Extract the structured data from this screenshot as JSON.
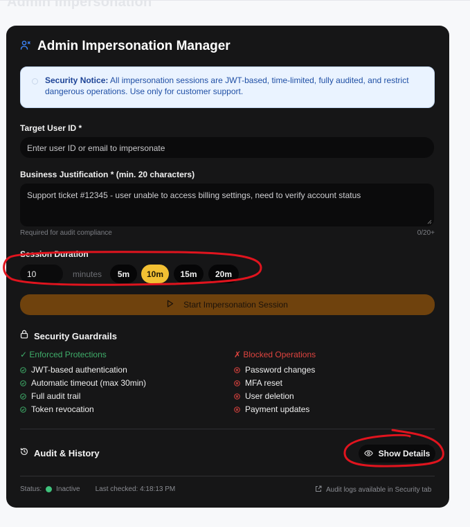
{
  "page": {
    "heading": "Admin Impersonation"
  },
  "card": {
    "title": "Admin Impersonation Manager",
    "icon": "user-switch-icon",
    "notice": {
      "label": "Security Notice:",
      "text": "All impersonation sessions are JWT-based, time-limited, fully audited, and restrict dangerous operations. Use only for customer support."
    },
    "target_user": {
      "label": "Target User ID *",
      "value": "",
      "placeholder": "Enter user ID or email to impersonate"
    },
    "justification": {
      "label": "Business Justification * (min. 20 characters)",
      "value": "Support ticket #12345 - user unable to access billing settings, need to verify account status",
      "hint": "Required for audit compliance",
      "counter": "0/20+"
    },
    "duration": {
      "label": "Session Duration",
      "value": "10",
      "unit": "minutes",
      "options": [
        "5m",
        "10m",
        "15m",
        "20m"
      ],
      "selected": "10m"
    },
    "start_button": {
      "label": "Start Impersonation Session",
      "icon": "play-icon"
    },
    "guardrails": {
      "title": "Security Guardrails",
      "enforced_title": "✓ Enforced Protections",
      "enforced": [
        "JWT-based authentication",
        "Automatic timeout (max 30min)",
        "Full audit trail",
        "Token revocation"
      ],
      "blocked_title": "✗ Blocked Operations",
      "blocked": [
        "Password changes",
        "MFA reset",
        "User deletion",
        "Payment updates"
      ]
    },
    "audit": {
      "title": "Audit & History",
      "button": "Show Details"
    },
    "footer": {
      "status_label": "Status:",
      "status_value": "Inactive",
      "last_checked": "Last checked: 4:18:13 PM",
      "audit_note": "Audit logs available in Security tab"
    }
  },
  "colors": {
    "card_bg": "#161617",
    "accent_yellow": "#f2c033",
    "start_button": "#6f420d",
    "notice_bg": "#eaf3ff",
    "enforced": "#3fae6a",
    "blocked": "#e0443f",
    "annotation": "#e0141e"
  }
}
